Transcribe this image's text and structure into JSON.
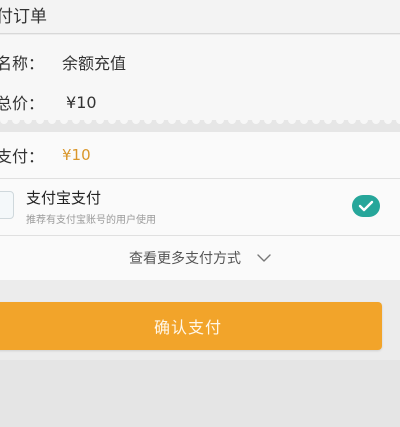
{
  "header": {
    "title": "付订单"
  },
  "order": {
    "name_label": "名称：",
    "name_value": "余额充值",
    "total_label": "总价：",
    "total_value": "¥10"
  },
  "payment": {
    "amount_label": "支付：",
    "amount_value": "¥10",
    "method": {
      "name": "支付宝支付",
      "description": "推荐有支付宝账号的用户使用",
      "icon": "alipay-icon",
      "selected": true
    },
    "more_methods_label": "查看更多支付方式",
    "more_icon": "chevron-down-icon"
  },
  "actions": {
    "confirm_label": "确认支付"
  },
  "colors": {
    "accent": "#f2a42a",
    "amount": "#d9962a",
    "check": "#26a69a"
  }
}
